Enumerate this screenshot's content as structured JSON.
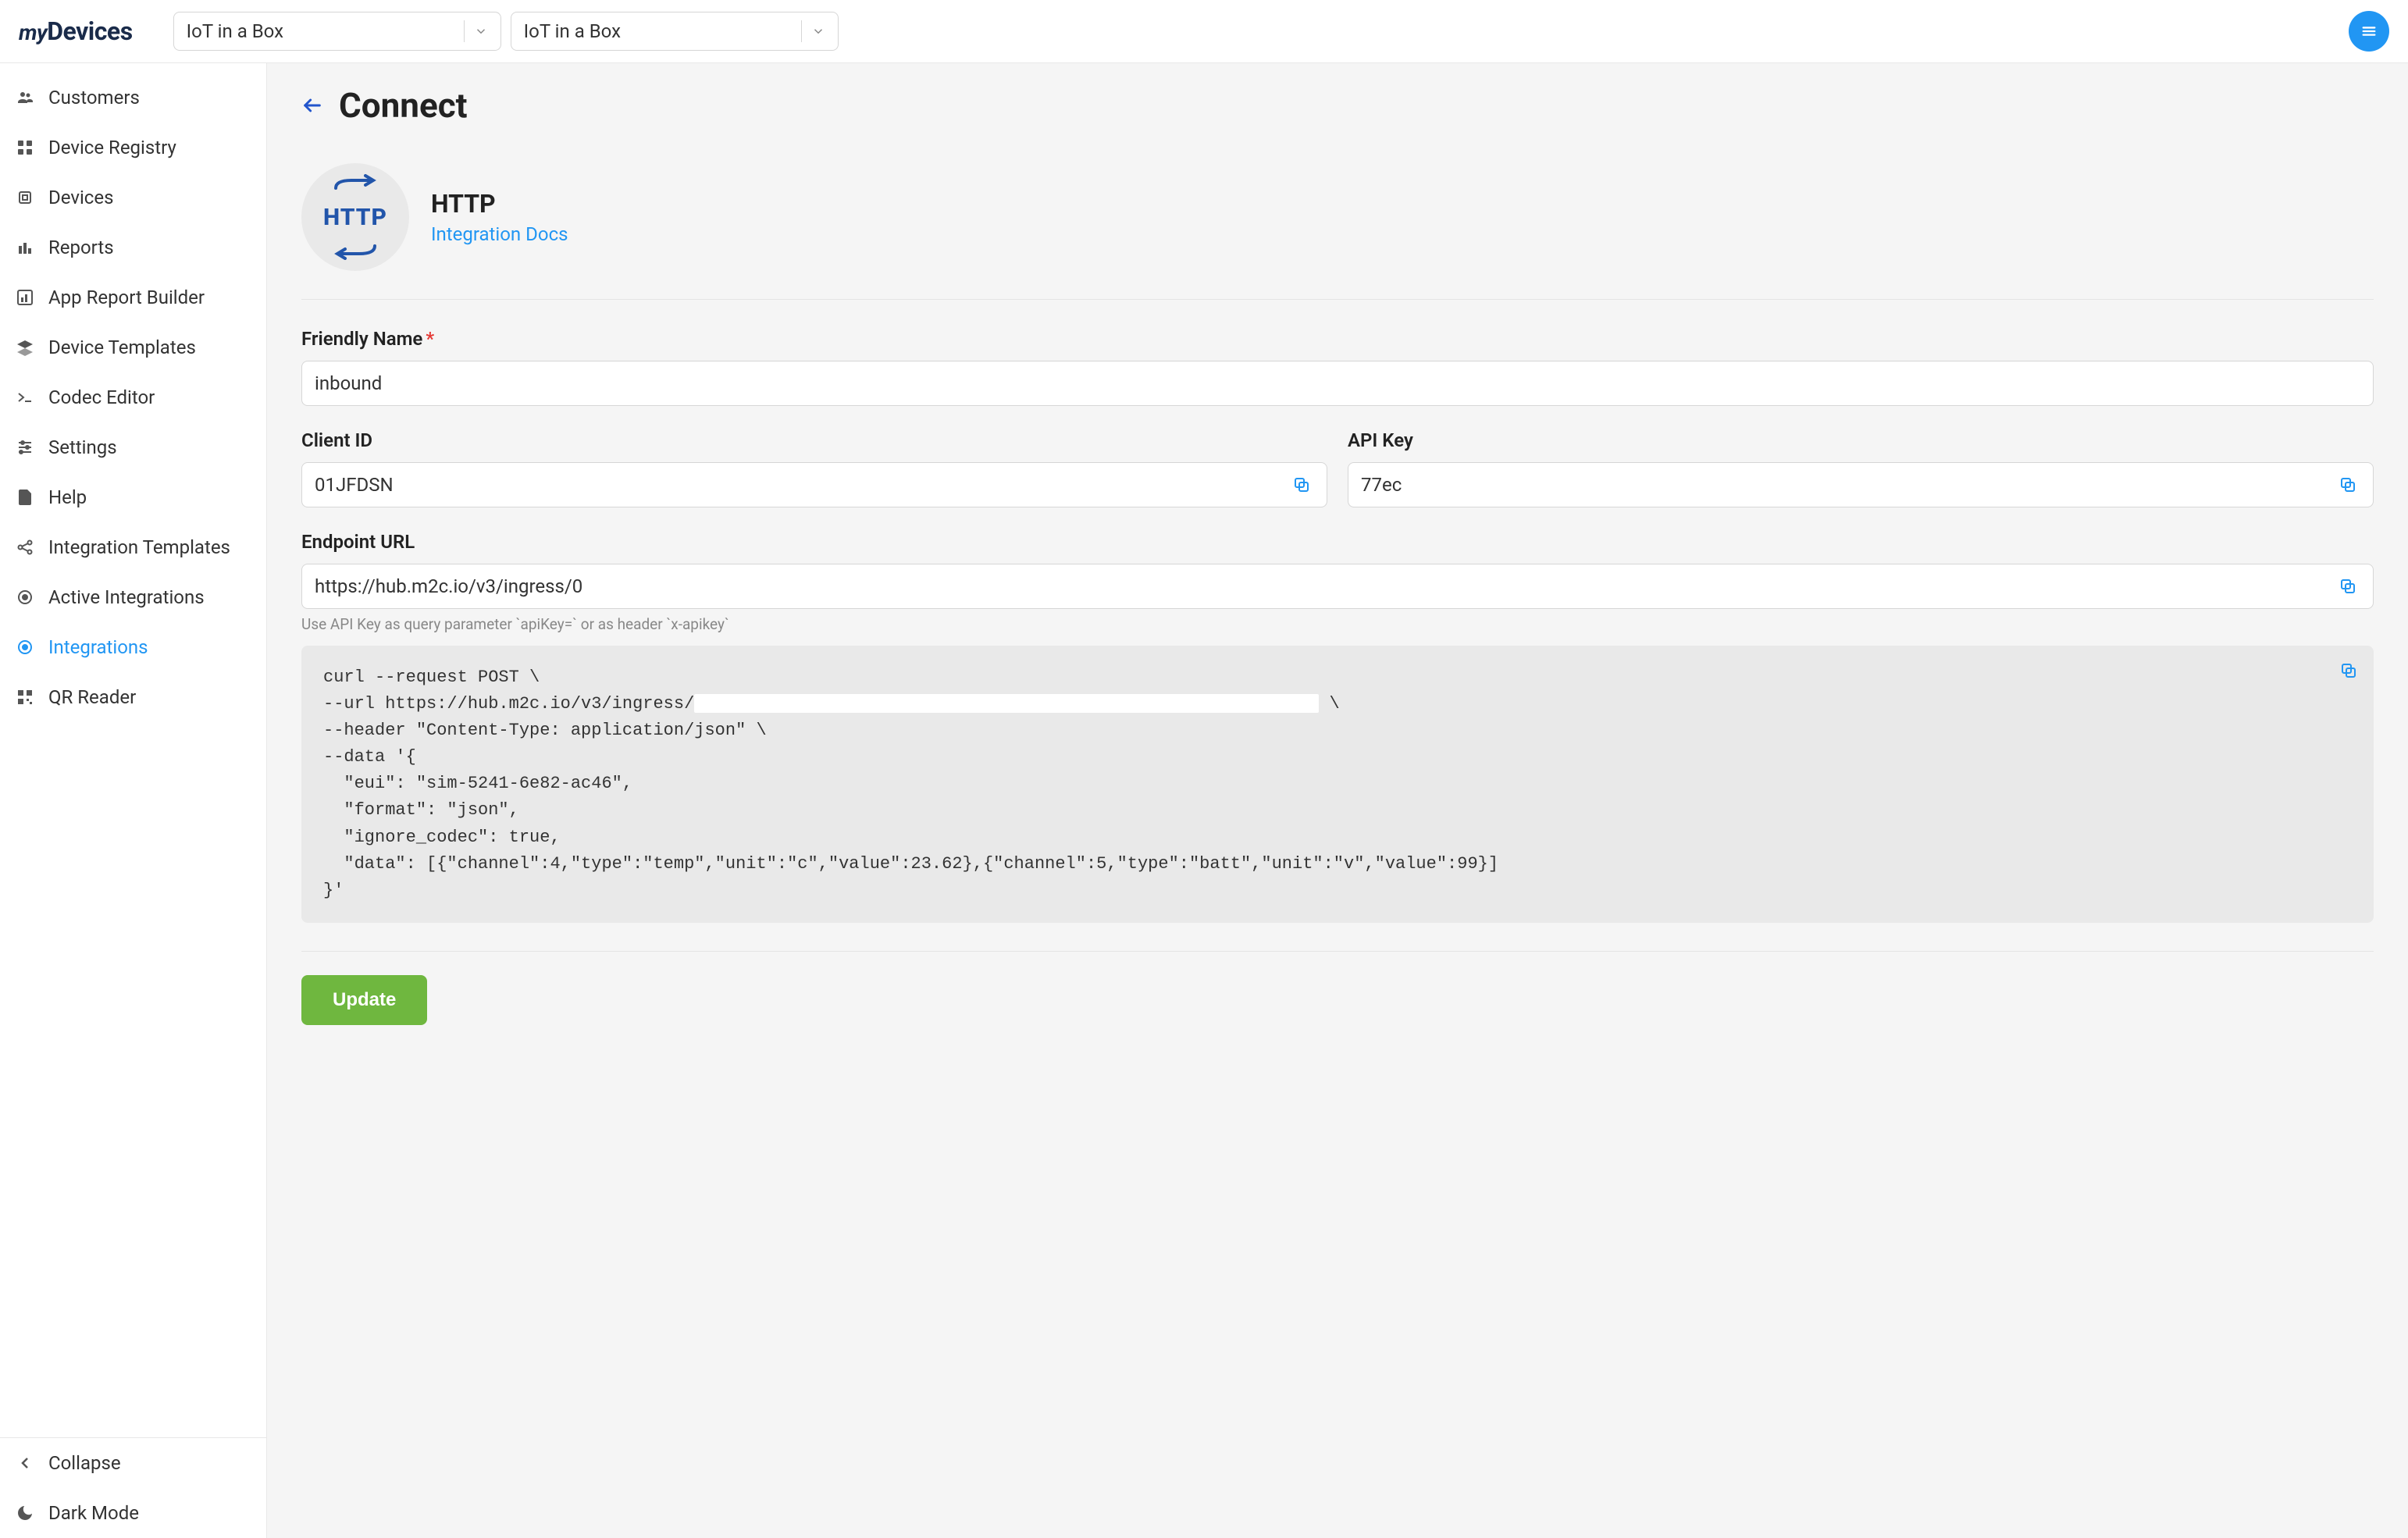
{
  "logo": {
    "my": "my",
    "devices": "Devices"
  },
  "header": {
    "select1": "IoT in a Box",
    "select2": "IoT in a Box"
  },
  "sidebar": {
    "items": [
      {
        "id": "customers",
        "label": "Customers"
      },
      {
        "id": "device-registry",
        "label": "Device Registry"
      },
      {
        "id": "devices",
        "label": "Devices"
      },
      {
        "id": "reports",
        "label": "Reports"
      },
      {
        "id": "app-report-builder",
        "label": "App Report Builder"
      },
      {
        "id": "device-templates",
        "label": "Device Templates"
      },
      {
        "id": "codec-editor",
        "label": "Codec Editor"
      },
      {
        "id": "settings",
        "label": "Settings"
      },
      {
        "id": "help",
        "label": "Help"
      },
      {
        "id": "integration-templates",
        "label": "Integration Templates"
      },
      {
        "id": "active-integrations",
        "label": "Active Integrations"
      },
      {
        "id": "integrations",
        "label": "Integrations"
      },
      {
        "id": "qr-reader",
        "label": "QR Reader"
      }
    ],
    "collapse": "Collapse",
    "dark_mode": "Dark Mode"
  },
  "page": {
    "title": "Connect",
    "integration_name": "HTTP",
    "integration_docs": "Integration Docs",
    "friendly_name_label": "Friendly Name",
    "friendly_name_value": "inbound",
    "client_id_label": "Client ID",
    "client_id_value": "01JFDSN",
    "api_key_label": "API Key",
    "api_key_value": "77ec",
    "endpoint_label": "Endpoint URL",
    "endpoint_value": "https://hub.m2c.io/v3/ingress/0",
    "endpoint_hint": "Use API Key as query parameter `apiKey=` or as header `x-apikey`",
    "curl_line1": "curl --request POST \\",
    "curl_line2_a": "--url https://hub.m2c.io/v3/ingress/",
    "curl_line2_b": " \\",
    "curl_line3": "--header \"Content-Type: application/json\" \\",
    "curl_line4": "--data '{",
    "curl_line5": "  \"eui\": \"sim-5241-6e82-ac46\",",
    "curl_line6": "  \"format\": \"json\",",
    "curl_line7": "  \"ignore_codec\": true,",
    "curl_line8": "  \"data\": [{\"channel\":4,\"type\":\"temp\",\"unit\":\"c\",\"value\":23.62},{\"channel\":5,\"type\":\"batt\",\"unit\":\"v\",\"value\":99}]",
    "curl_line9": "}'",
    "update_label": "Update"
  }
}
